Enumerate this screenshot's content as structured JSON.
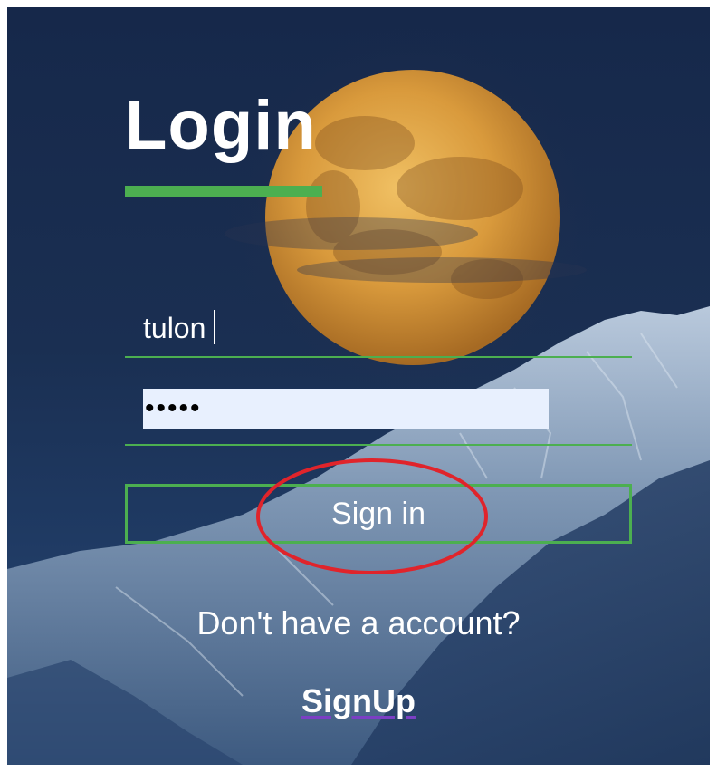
{
  "login": {
    "title": "Login",
    "username_value": "tulon",
    "password_value": "•••••",
    "signin_label": "Sign in",
    "no_account_text": "Don't have a account?",
    "signup_label": "SignUp"
  },
  "colors": {
    "accent": "#4caf50",
    "highlight_circle": "#e0242b",
    "autofill_bg": "#e8f0fe",
    "link_underline": "#7b3fc4"
  }
}
